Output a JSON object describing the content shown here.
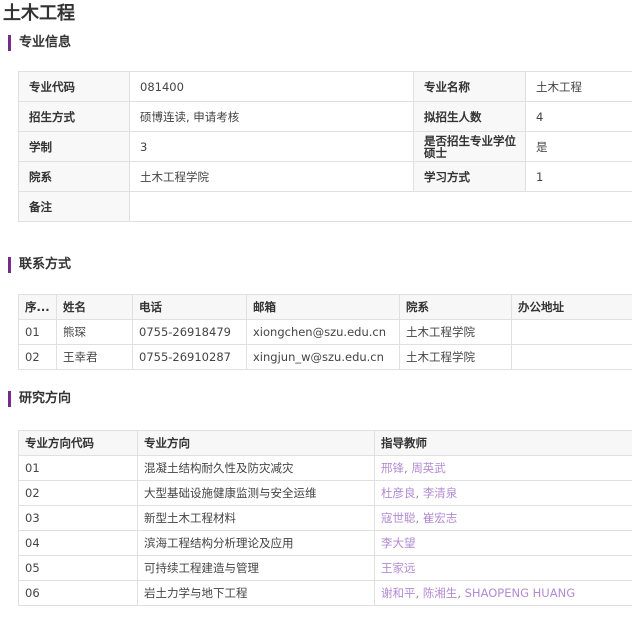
{
  "page_title": "土木工程",
  "info": {
    "heading": "专业信息",
    "rows": [
      {
        "k1": "专业代码",
        "v1": "081400",
        "k2": "专业名称",
        "v2": "土木工程"
      },
      {
        "k1": "招生方式",
        "v1": "硕博连读, 申请考核",
        "k2": "拟招生人数",
        "v2": "4"
      },
      {
        "k1": "学制",
        "v1": "3",
        "k2": "是否招生专业学位硕士",
        "v2": "是"
      },
      {
        "k1": "院系",
        "v1": "土木工程学院",
        "k2": "学习方式",
        "v2": "1"
      },
      {
        "k1": "备注",
        "v1": ""
      }
    ]
  },
  "contact": {
    "heading": "联系方式",
    "headers": [
      "序...",
      "姓名",
      "电话",
      "邮箱",
      "院系",
      "办公地址"
    ],
    "rows": [
      [
        "01",
        "熊琛",
        "0755-26918479",
        "xiongchen@szu.edu.cn",
        "土木工程学院",
        ""
      ],
      [
        "02",
        "王幸君",
        "0755-26910287",
        "xingjun_w@szu.edu.cn",
        "土木工程学院",
        ""
      ]
    ]
  },
  "research": {
    "heading": "研究方向",
    "headers": [
      "专业方向代码",
      "专业方向",
      "指导教师"
    ],
    "rows": [
      {
        "code": "01",
        "direction": "混凝土结构耐久性及防灾减灾",
        "teachers": [
          "邢锋",
          "周英武"
        ]
      },
      {
        "code": "02",
        "direction": "大型基础设施健康监测与安全运维",
        "teachers": [
          "杜彦良",
          "李清泉"
        ]
      },
      {
        "code": "03",
        "direction": "新型土木工程材料",
        "teachers": [
          "寇世聪",
          "崔宏志"
        ]
      },
      {
        "code": "04",
        "direction": "滨海工程结构分析理论及应用",
        "teachers": [
          "李大望"
        ]
      },
      {
        "code": "05",
        "direction": "可持续工程建造与管理",
        "teachers": [
          "王家远"
        ]
      },
      {
        "code": "06",
        "direction": "岩土力学与地下工程",
        "teachers": [
          "谢和平",
          "陈湘生",
          "SHAOPENG HUANG"
        ]
      }
    ],
    "separator": ","
  },
  "colors": {
    "accent": "#7a2a8a",
    "link": "#b38ad3"
  }
}
